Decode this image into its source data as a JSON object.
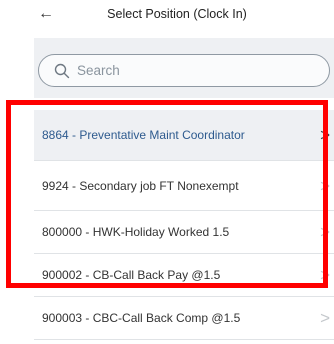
{
  "header": {
    "back_glyph": "←",
    "title": "Select Position (Clock In)"
  },
  "search": {
    "placeholder": "Search",
    "value": ""
  },
  "positions": [
    {
      "label": "8864 - Preventative Maint Coordinator"
    },
    {
      "label": "9924 - Secondary job FT Nonexempt"
    },
    {
      "label": "800000 - HWK-Holiday Worked 1.5"
    },
    {
      "label": "900002 - CB-Call Back Pay @1.5"
    },
    {
      "label": "900003 - CBC-Call Back Comp @1.5"
    }
  ],
  "chevron_glyph": ">",
  "colors": {
    "highlight_border": "#ff0000",
    "selected_text": "#2d5a8e",
    "panel_bg": "#eef0f3"
  },
  "icons": {
    "back": "arrow-left-icon",
    "search": "search-icon",
    "item": "chevron-right-icon"
  }
}
